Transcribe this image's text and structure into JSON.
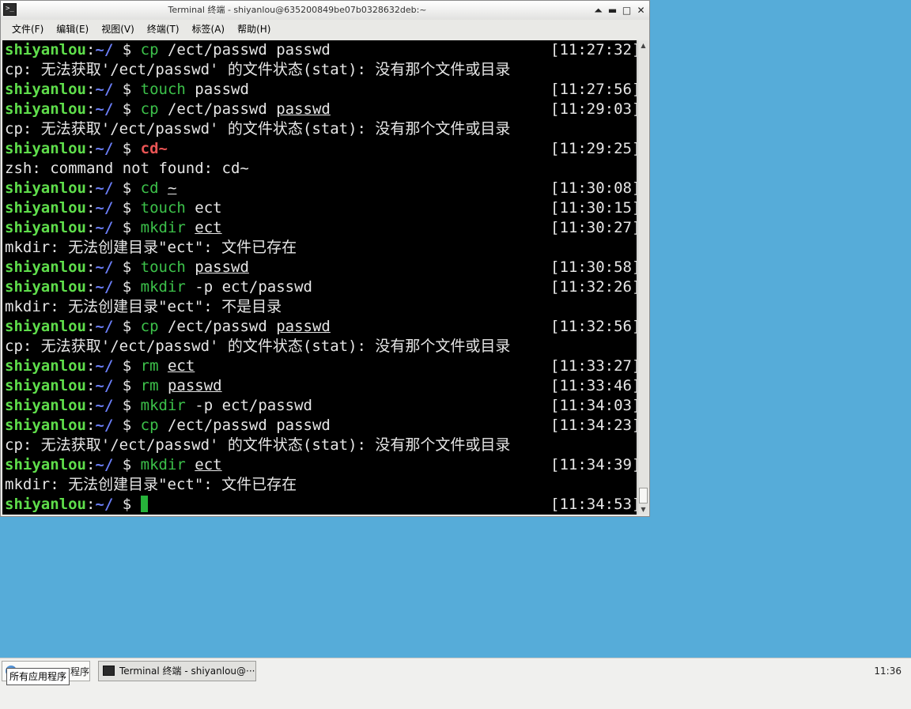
{
  "window": {
    "title": "Terminal 终端 - shiyanlou@635200849be07b0328632deb:~",
    "controls": {
      "shade": "⏶",
      "minimize": "▬",
      "maximize": "□",
      "close": "✕"
    }
  },
  "menu": [
    "文件(F)",
    "编辑(E)",
    "视图(V)",
    "终端(T)",
    "标签(A)",
    "帮助(H)"
  ],
  "prompt": {
    "user": "shiyanlou",
    "colon": ":",
    "path": "~/",
    "sign": " $ "
  },
  "lines": [
    {
      "kind": "prompt",
      "cmd": "cp",
      "cmd_style": "ok",
      "args": [
        {
          "t": " /ect/passwd passwd"
        }
      ],
      "time": "[11:27:32]"
    },
    {
      "kind": "output",
      "text": "cp: 无法获取'/ect/passwd' 的文件状态(stat): 没有那个文件或目录"
    },
    {
      "kind": "prompt",
      "cmd": "touch",
      "cmd_style": "ok",
      "args": [
        {
          "t": " passwd"
        }
      ],
      "time": "[11:27:56]"
    },
    {
      "kind": "prompt",
      "cmd": "cp",
      "cmd_style": "ok",
      "args": [
        {
          "t": " /ect/passwd "
        },
        {
          "t": "passwd",
          "u": true
        }
      ],
      "time": "[11:29:03]"
    },
    {
      "kind": "output",
      "text": "cp: 无法获取'/ect/passwd' 的文件状态(stat): 没有那个文件或目录"
    },
    {
      "kind": "prompt",
      "cmd": "cd~",
      "cmd_style": "bad",
      "args": [],
      "time": "[11:29:25]"
    },
    {
      "kind": "output",
      "text": "zsh: command not found: cd~"
    },
    {
      "kind": "prompt",
      "cmd": "cd",
      "cmd_style": "ok",
      "args": [
        {
          "t": " "
        },
        {
          "t": "~",
          "u": true
        }
      ],
      "time": "[11:30:08]"
    },
    {
      "kind": "prompt",
      "cmd": "touch",
      "cmd_style": "ok",
      "args": [
        {
          "t": " ect"
        }
      ],
      "time": "[11:30:15]"
    },
    {
      "kind": "prompt",
      "cmd": "mkdir",
      "cmd_style": "ok",
      "args": [
        {
          "t": " "
        },
        {
          "t": "ect",
          "u": true
        }
      ],
      "time": "[11:30:27]"
    },
    {
      "kind": "output",
      "text": "mkdir: 无法创建目录\"ect\": 文件已存在"
    },
    {
      "kind": "prompt",
      "cmd": "touch",
      "cmd_style": "ok",
      "args": [
        {
          "t": " "
        },
        {
          "t": "passwd",
          "u": true
        }
      ],
      "time": "[11:30:58]"
    },
    {
      "kind": "prompt",
      "cmd": "mkdir",
      "cmd_style": "ok",
      "args": [
        {
          "t": " -p ect/passwd"
        }
      ],
      "time": "[11:32:26]"
    },
    {
      "kind": "output",
      "text": "mkdir: 无法创建目录\"ect\": 不是目录"
    },
    {
      "kind": "prompt",
      "cmd": "cp",
      "cmd_style": "ok",
      "args": [
        {
          "t": " /ect/passwd "
        },
        {
          "t": "passwd",
          "u": true
        }
      ],
      "time": "[11:32:56]"
    },
    {
      "kind": "output",
      "text": "cp: 无法获取'/ect/passwd' 的文件状态(stat): 没有那个文件或目录"
    },
    {
      "kind": "prompt",
      "cmd": "rm",
      "cmd_style": "ok",
      "args": [
        {
          "t": " "
        },
        {
          "t": "ect",
          "u": true
        }
      ],
      "time": "[11:33:27]"
    },
    {
      "kind": "prompt",
      "cmd": "rm",
      "cmd_style": "ok",
      "args": [
        {
          "t": " "
        },
        {
          "t": "passwd",
          "u": true
        }
      ],
      "time": "[11:33:46]"
    },
    {
      "kind": "prompt",
      "cmd": "mkdir",
      "cmd_style": "ok",
      "args": [
        {
          "t": " -p ect/passwd"
        }
      ],
      "time": "[11:34:03]"
    },
    {
      "kind": "prompt",
      "cmd": "cp",
      "cmd_style": "ok",
      "args": [
        {
          "t": " /ect/passwd passwd"
        }
      ],
      "time": "[11:34:23]"
    },
    {
      "kind": "output",
      "text": "cp: 无法获取'/ect/passwd' 的文件状态(stat): 没有那个文件或目录"
    },
    {
      "kind": "prompt",
      "cmd": "mkdir",
      "cmd_style": "ok",
      "args": [
        {
          "t": " "
        },
        {
          "t": "ect",
          "u": true
        }
      ],
      "time": "[11:34:39]"
    },
    {
      "kind": "output",
      "text": "mkdir: 无法创建目录\"ect\": 文件已存在"
    },
    {
      "kind": "prompt",
      "cmd": "",
      "cmd_style": "ok",
      "args": [],
      "cursor": true,
      "time": "[11:34:53]"
    }
  ],
  "taskbar": {
    "start_label": "程序",
    "start_tooltip": "所有应用程序",
    "task_label": "Terminal 终端 - shiyanlou@···",
    "clock": "11:36"
  },
  "colors": {
    "desktop": "#56acd9",
    "user": "#5fde4b",
    "path": "#6a7df5",
    "command": "#3cc14a",
    "bad_command": "#e95454",
    "cursor": "#26b33a"
  }
}
